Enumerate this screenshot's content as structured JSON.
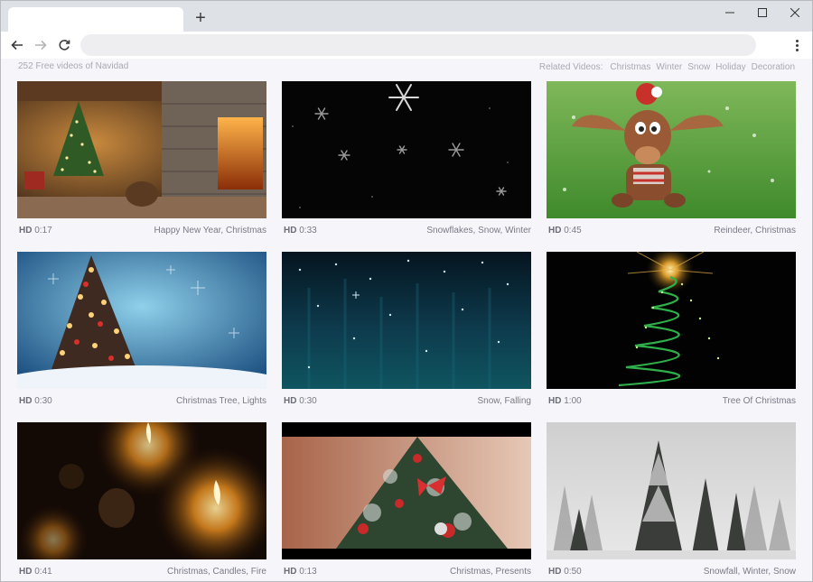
{
  "browser": {
    "new_tab_symbol": "+",
    "icons": {
      "back": "arrow-left-icon",
      "forward": "arrow-right-icon",
      "reload": "reload-icon",
      "menu": "kebab-menu-icon"
    }
  },
  "page": {
    "count_text": "252 Free videos of Navidad",
    "related_label": "Related Videos:",
    "related": [
      "Christmas",
      "Winter",
      "Snow",
      "Holiday",
      "Decoration"
    ]
  },
  "videos": [
    {
      "hd": "HD",
      "duration": "0:17",
      "tags": "Happy New Year, Christmas"
    },
    {
      "hd": "HD",
      "duration": "0:33",
      "tags": "Snowflakes, Snow, Winter"
    },
    {
      "hd": "HD",
      "duration": "0:45",
      "tags": "Reindeer, Christmas"
    },
    {
      "hd": "HD",
      "duration": "0:30",
      "tags": "Christmas Tree, Lights"
    },
    {
      "hd": "HD",
      "duration": "0:30",
      "tags": "Snow, Falling"
    },
    {
      "hd": "HD",
      "duration": "1:00",
      "tags": "Tree Of Christmas"
    },
    {
      "hd": "HD",
      "duration": "0:41",
      "tags": "Christmas, Candles, Fire"
    },
    {
      "hd": "HD",
      "duration": "0:13",
      "tags": "Christmas, Presents"
    },
    {
      "hd": "HD",
      "duration": "0:50",
      "tags": "Snowfall, Winter, Snow"
    }
  ],
  "colors": {
    "background": "#f6f5fa",
    "tabstrip": "#dee1e6",
    "muted_text": "#a9a9b2"
  }
}
